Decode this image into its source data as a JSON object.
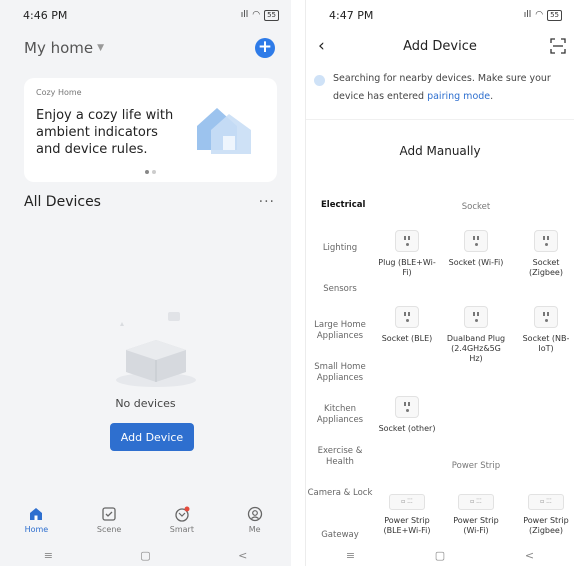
{
  "left": {
    "status": {
      "time": "4:46 PM",
      "battery": "55"
    },
    "home_title": "My home",
    "banner": {
      "kicker": "Cozy Home",
      "text": "Enjoy a cozy life with ambient indicators and device rules."
    },
    "section_title": "All Devices",
    "empty_text": "No devices",
    "add_button": "Add Device",
    "tabs": [
      {
        "label": "Home",
        "icon": "home-icon"
      },
      {
        "label": "Scene",
        "icon": "checkbox-icon"
      },
      {
        "label": "Smart",
        "icon": "smart-icon"
      },
      {
        "label": "Me",
        "icon": "profile-icon"
      }
    ],
    "nav": {
      "menu": "≡",
      "home": "▢",
      "back": "<"
    }
  },
  "right": {
    "status": {
      "time": "4:47 PM",
      "battery": "55"
    },
    "title": "Add Device",
    "search_text": "Searching for nearby devices. Make sure your device has entered ",
    "search_link": "pairing mode",
    "search_end": ".",
    "manual_title": "Add Manually",
    "categories": [
      "Electrical",
      "Lighting",
      "Sensors",
      "Large Home Appliances",
      "Small Home Appliances",
      "Kitchen Appliances",
      "Exercise & Health",
      "Camera & Lock",
      "Gateway"
    ],
    "socket_heading": "Socket",
    "sockets": [
      "Plug (BLE+Wi-Fi)",
      "Socket (Wi-Fi)",
      "Socket (Zigbee)",
      "Socket (BLE)",
      "Dualband Plug (2.4GHz&5G Hz)",
      "Socket (NB-IoT)",
      "Socket (other)"
    ],
    "strip_heading": "Power Strip",
    "strips": [
      "Power Strip (BLE+Wi-Fi)",
      "Power Strip (Wi-Fi)",
      "Power Strip (Zigbee)"
    ],
    "nav": {
      "menu": "≡",
      "home": "▢",
      "back": "<"
    }
  }
}
